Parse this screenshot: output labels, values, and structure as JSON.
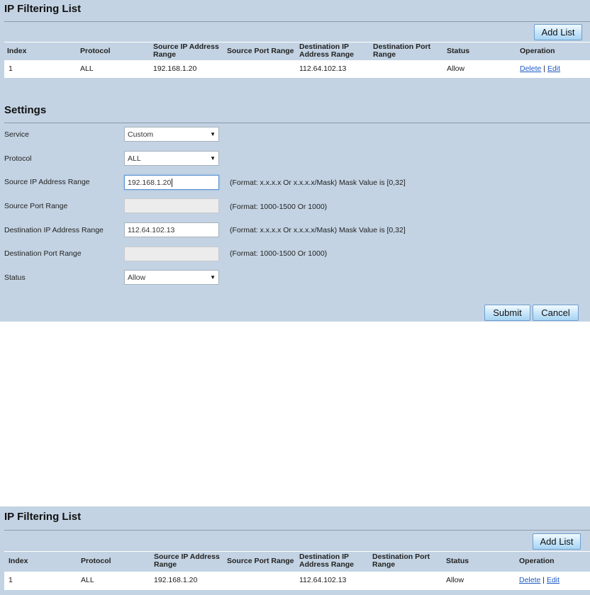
{
  "list": {
    "title": "IP Filtering List",
    "add_button": "Add List",
    "headers": {
      "index": "Index",
      "protocol": "Protocol",
      "src_ip_1": "Source IP Address",
      "src_ip_2": "Range",
      "src_port": "Source Port Range",
      "dst_ip_1": "Destination IP",
      "dst_ip_2": "Address Range",
      "dst_port_1": "Destination Port",
      "dst_port_2": "Range",
      "status": "Status",
      "operation": "Operation"
    },
    "rows": [
      {
        "index": "1",
        "protocol": "ALL",
        "src_ip": "192.168.1.20",
        "src_port": "",
        "dst_ip": "112.64.102.13",
        "dst_port": "",
        "status": "Allow",
        "delete": "Delete",
        "sep": "|",
        "edit": "Edit"
      }
    ]
  },
  "settings": {
    "title": "Settings",
    "service": {
      "label": "Service",
      "value": "Custom"
    },
    "protocol": {
      "label": "Protocol",
      "value": "ALL"
    },
    "src_ip": {
      "label": "Source IP Address Range",
      "value": "192.168.1.20",
      "hint": "(Format: x.x.x.x Or x.x.x.x/Mask) Mask Value is [0,32]"
    },
    "src_port": {
      "label": "Source Port Range",
      "value": "",
      "hint": "(Format: 1000-1500 Or 1000)"
    },
    "dst_ip": {
      "label": "Destination IP Address Range",
      "value": "112.64.102.13",
      "hint": "(Format: x.x.x.x Or x.x.x.x/Mask) Mask Value is [0,32]"
    },
    "dst_port": {
      "label": "Destination Port Range",
      "value": "",
      "hint": "(Format: 1000-1500 Or 1000)"
    },
    "status": {
      "label": "Status",
      "value": "Allow"
    },
    "submit": "Submit",
    "cancel": "Cancel"
  },
  "icons": {
    "dropdown": "chevron-down-icon",
    "caret_glyph": "▼"
  }
}
